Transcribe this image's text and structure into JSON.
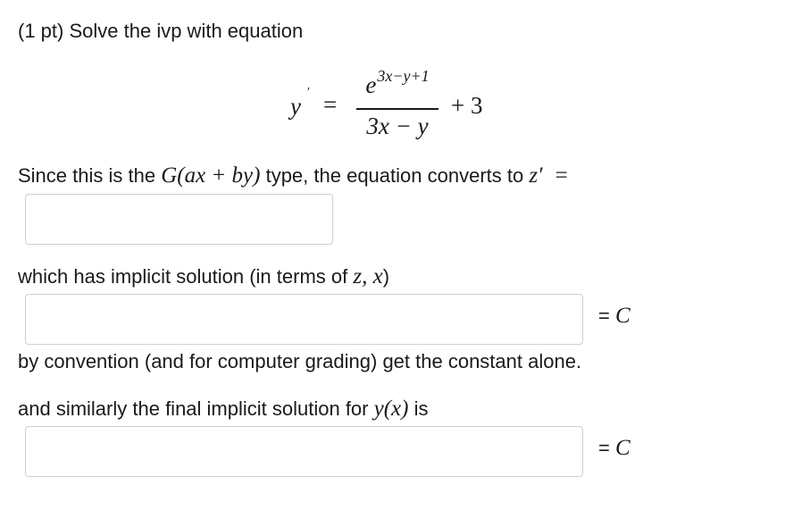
{
  "header": {
    "points": "(1 pt)",
    "text": "Solve the ivp with equation"
  },
  "equation": {
    "lhs": "y",
    "prime": "′",
    "equals": "=",
    "numerator_base": "e",
    "numerator_exponent": "3x−y+1",
    "denominator": "3x − y",
    "plus_term": "+ 3"
  },
  "convert": {
    "before": "Since this is the ",
    "type_math": "G(ax + by)",
    "after": " type, the equation converts to ",
    "target_math": "z′",
    "equals": "="
  },
  "answers": [
    {
      "value": "",
      "placeholder": ""
    },
    {
      "value": "",
      "placeholder": ""
    },
    {
      "value": "",
      "placeholder": ""
    }
  ],
  "implicit": {
    "before": "which has implicit solution (in terms of ",
    "vars_math": "z, x",
    "after": ")"
  },
  "equals_c": {
    "equals": "=",
    "constant": "C"
  },
  "convention": {
    "text": "by convention (and for computer grading) get the constant alone."
  },
  "final": {
    "before": "and similarly the final implicit solution for ",
    "func_math": "y(x)",
    "after": " is"
  }
}
